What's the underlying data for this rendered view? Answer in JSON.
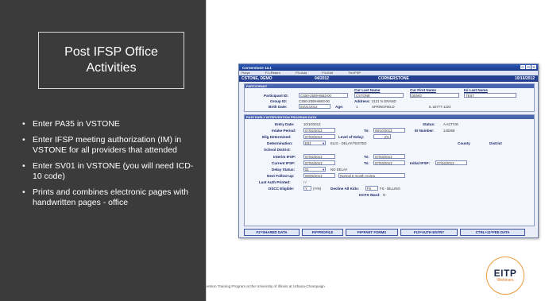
{
  "slide": {
    "title_line1": "Post IFSP Office",
    "title_line2": "Activities",
    "bullets": [
      "Enter PA35 in VSTONE",
      "Enter IFSP meeting authorization (IM) in VSTONE for all providers that attended",
      "Enter SV01 in VSTONE (you will need ICD-10 code)",
      "Prints and combines electronic pages with handwritten pages - office"
    ],
    "footer": "ention Training Program at the University of Illinois at Urbana-Champaign",
    "logo_text": "EITP",
    "logo_sub": "Webinars"
  },
  "window": {
    "title": "Cornerstone 13.1",
    "menu": [
      "Fkeys",
      "F1=Return",
      "F3=Add",
      "F4=Edit",
      "Tb=IFSP"
    ],
    "header": [
      "CSTONE, DEMO",
      "04/2012",
      "CORNERSTONE",
      "10/16/2012"
    ],
    "participant_section": "PARTICIPANT",
    "col_cur_last": "Cur Last Name",
    "col_cur_first": "Cur First Name",
    "col_ini_last": "Ini Last Name",
    "participant_id_label": "Participant ID:",
    "participant_id": "CS50-2509-8683-00",
    "cur_last": "CSTONE",
    "cur_first": "DEMO",
    "ini_last": "TEST",
    "group_id_label": "Group ID:",
    "group_id": "CS50-2509-8683-00",
    "address_label": "Address:",
    "address": "2121 N GRAND",
    "birth_label": "Birth Date:",
    "birth_date": "03/21/2012",
    "age_label": "Age:",
    "age": "1",
    "city": "SPRINGFIELD",
    "state_zip": "IL  62777-1224",
    "ei_section": "PA35 EARLY INTERVENTION PROGRAM DATA",
    "entry_label": "Entry Date:",
    "entry_date": "10/10/2013",
    "status_label": "Status:",
    "status": "A   ACTIVE",
    "intake_label": "Intake Period:",
    "intake_from": "07/02/2013",
    "to_label": "To:",
    "intake_to": "09/10/2013",
    "ei_number_label": "EI Number:",
    "ei_number": "140268",
    "elig_label": "Elig Determined:",
    "elig_date": "07/03/2013",
    "delay_label": "Level of Delay:",
    "delay_pct": "2%",
    "det_label": "Determination:",
    "det_code": "E01",
    "det_text": "ELIG - DELAY/TESTED",
    "county_label": "County",
    "district_label": "District",
    "school_label": "School District:",
    "interim_label": "Interim IFSP:",
    "interim_from": "07/02/2013",
    "interim_to": "07/03/2013",
    "current_label": "Current IFSP:",
    "current_from": "07/04/2013",
    "current_to": "07/03/2013",
    "initial_label": "Initial IFSP:",
    "initial_date": "07/04/2013",
    "delay_status_label": "Delay Status:",
    "delay_status_code": "01",
    "delay_status_text": "NO DELAY",
    "followup_label": "Next Follow-up:",
    "followup_date": "08/05/2013",
    "followup_text": "Normal 6 month review",
    "auth_label": "Last Auth Printed:",
    "auth_value": "/ /",
    "dscc_label": "DSCC Eligible:",
    "dscc_value": "Y",
    "dscc_hint": "(Y/N)",
    "decline_label": "Decline All Kids:",
    "decline_code": "F5",
    "decline_text": "FS - BILLING",
    "dcfs_label": "DCFS Ward:",
    "dcfs_value": "N",
    "buttons": [
      "F2=SHARED DATA",
      "F8=PROFILE",
      "F9=PART FORMS",
      "F10=AUTH ENTRY",
      "CTRL+11=FEE DATA"
    ]
  }
}
